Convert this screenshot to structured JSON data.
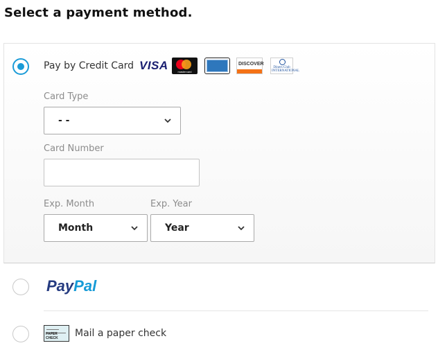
{
  "heading": "Select a payment method.",
  "credit_card": {
    "label": "Pay by Credit Card",
    "selected": true,
    "logos": {
      "visa": "VISA",
      "mastercard": "mastercard",
      "discover": "DISCOVER",
      "diners": "Diners Club INTERNATIONAL"
    },
    "card_type": {
      "label": "Card Type",
      "value": "- -"
    },
    "card_number": {
      "label": "Card Number",
      "value": ""
    },
    "exp_month": {
      "label": "Exp. Month",
      "value": "Month"
    },
    "exp_year": {
      "label": "Exp. Year",
      "value": "Year"
    }
  },
  "paypal": {
    "pay": "Pay",
    "pal": "Pal",
    "selected": false
  },
  "check": {
    "label": "Mail a paper check",
    "icon_text": "PAPER CHECK",
    "selected": false
  },
  "colors": {
    "accent": "#1a9bd7",
    "paypal_dark": "#253b80",
    "paypal_light": "#179bd7",
    "visa": "#1a1f71"
  }
}
